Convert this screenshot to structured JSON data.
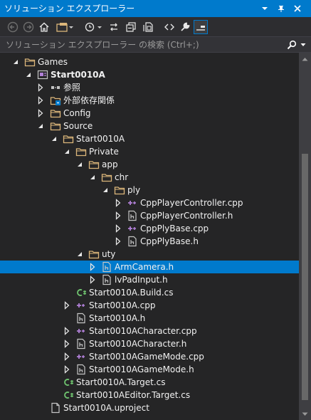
{
  "window": {
    "title": "ソリューション エクスプローラー"
  },
  "search": {
    "placeholder": "ソリューション エクスプローラー の検索 (Ctrl+;)"
  },
  "tree": [
    {
      "label": "Games",
      "icon": "folder-icon",
      "expander": "expanded"
    },
    {
      "label": "Start0010A",
      "icon": "project-icon",
      "expander": "expanded",
      "bold": true
    },
    {
      "label": "参照",
      "icon": "references-icon",
      "expander": "collapsed"
    },
    {
      "label": "外部依存関係",
      "icon": "external-deps-icon",
      "expander": "collapsed"
    },
    {
      "label": "Config",
      "icon": "folder-icon",
      "expander": "collapsed"
    },
    {
      "label": "Source",
      "icon": "folder-icon",
      "expander": "expanded"
    },
    {
      "label": "Start0010A",
      "icon": "folder-icon",
      "expander": "expanded"
    },
    {
      "label": "Private",
      "icon": "folder-icon",
      "expander": "expanded"
    },
    {
      "label": "app",
      "icon": "folder-icon",
      "expander": "expanded"
    },
    {
      "label": "chr",
      "icon": "folder-icon",
      "expander": "expanded"
    },
    {
      "label": "ply",
      "icon": "folder-icon",
      "expander": "expanded"
    },
    {
      "label": "CppPlayerController.cpp",
      "icon": "cpp-file-icon",
      "expander": "collapsed"
    },
    {
      "label": "CppPlayerController.h",
      "icon": "header-file-icon",
      "expander": "collapsed"
    },
    {
      "label": "CppPlyBase.cpp",
      "icon": "cpp-file-icon",
      "expander": "collapsed"
    },
    {
      "label": "CppPlyBase.h",
      "icon": "header-file-icon",
      "expander": "collapsed"
    },
    {
      "label": "uty",
      "icon": "folder-icon",
      "expander": "expanded"
    },
    {
      "label": "ArmCamera.h",
      "icon": "header-file-icon",
      "expander": "collapsed",
      "selected": true
    },
    {
      "label": "lvPadInput.h",
      "icon": "header-file-icon",
      "expander": "collapsed"
    },
    {
      "label": "Start0010A.Build.cs",
      "icon": "csharp-file-icon",
      "expander": "none"
    },
    {
      "label": "Start0010A.cpp",
      "icon": "cpp-file-icon",
      "expander": "collapsed"
    },
    {
      "label": "Start0010A.h",
      "icon": "header-file-icon",
      "expander": "none"
    },
    {
      "label": "Start0010ACharacter.cpp",
      "icon": "cpp-file-icon",
      "expander": "collapsed"
    },
    {
      "label": "Start0010ACharacter.h",
      "icon": "header-file-icon",
      "expander": "collapsed"
    },
    {
      "label": "Start0010AGameMode.cpp",
      "icon": "cpp-file-icon",
      "expander": "collapsed"
    },
    {
      "label": "Start0010AGameMode.h",
      "icon": "header-file-icon",
      "expander": "collapsed"
    },
    {
      "label": "Start0010A.Target.cs",
      "icon": "csharp-file-icon",
      "expander": "none"
    },
    {
      "label": "Start0010AEditor.Target.cs",
      "icon": "csharp-file-icon",
      "expander": "none"
    },
    {
      "label": "Start0010A.uproject",
      "icon": "file-icon",
      "expander": "none"
    }
  ],
  "colors": {
    "accent": "#007acc",
    "background": "#252526",
    "toolbar": "#2d2d30",
    "folder": "#dcb67a",
    "cpp": "#b180d7",
    "csharp": "#6fc36f"
  }
}
